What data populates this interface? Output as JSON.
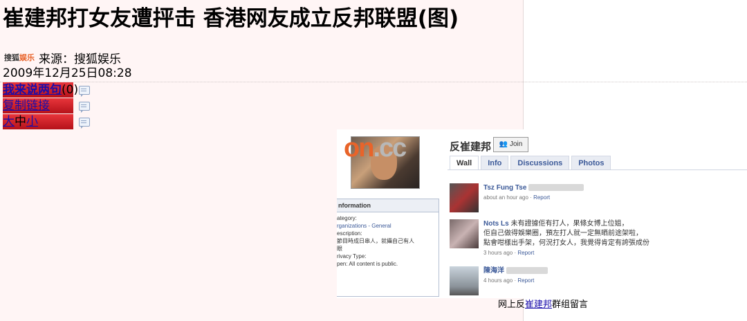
{
  "article": {
    "title": "崔建邦打女友遭抨击 香港网友成立反邦联盟(图)",
    "source_logo_a": "搜狐",
    "source_logo_b": "娱乐",
    "source": "来源：搜狐娱乐",
    "date": "2009年12月25日08:28"
  },
  "actions": {
    "comment_label": "我来说两句",
    "comment_count": "(0)",
    "copy_link": "复制链接",
    "size_large": "大",
    "size_medium": "中",
    "size_small": "小"
  },
  "screenshot": {
    "logo_on": "on",
    "logo_cc": ".cc",
    "group_name": "反崔建邦",
    "join_label": "Join",
    "tabs": [
      "Wall",
      "Info",
      "Discussions",
      "Photos"
    ],
    "info_title": "nformation",
    "info_lines": [
      "ategory:",
      "rganizations - General",
      "escription:",
      "節目時成日串人，就攝自己有人",
      "眼",
      "rivacy Type:",
      "pen: All content is public."
    ],
    "posts": [
      {
        "name": "Tsz Fung Tse",
        "text": "",
        "meta_time": "about an hour ago",
        "meta_link": "Report"
      },
      {
        "name": "Nots Ls",
        "text": "未有證據佢有打人，果條女博上位姐，",
        "text2": "佢自己做得娛樂圈，預左打人就一定無晒前途架啦，",
        "text3": "點會咁樣出手架，何況打女人，我覺得肯定有誇張成份",
        "meta_time": "3 hours ago",
        "meta_link": "Report"
      },
      {
        "name": "陳海洋",
        "text": "",
        "meta_time": "4 hours ago",
        "meta_link": "Report"
      }
    ]
  },
  "caption": {
    "before": "网上反",
    "link": "崔建邦",
    "after": "群组留言"
  }
}
